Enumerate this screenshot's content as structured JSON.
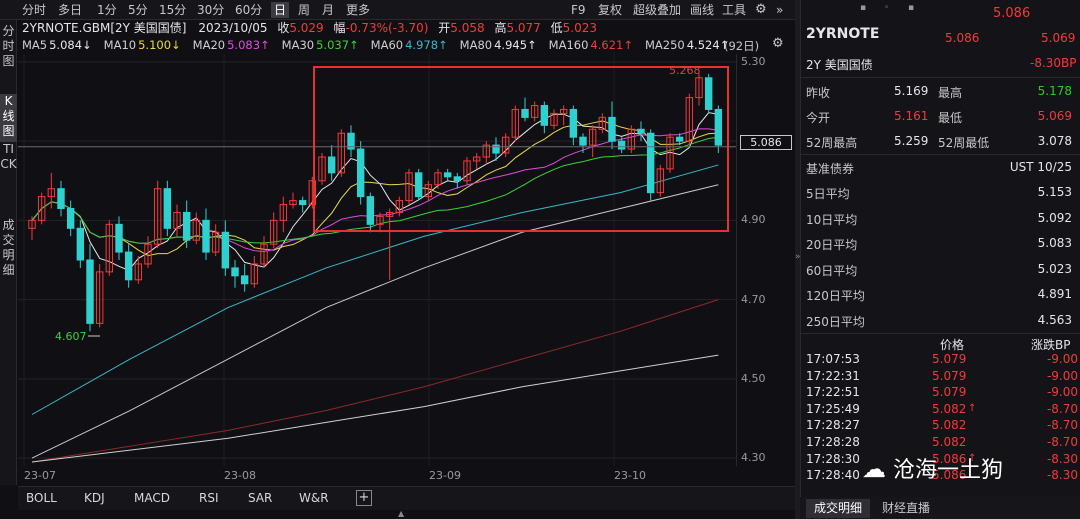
{
  "toolbar": {
    "left": [
      "分时",
      "多日",
      "1分",
      "5分",
      "15分",
      "30分",
      "60分",
      "日",
      "周",
      "月",
      "更多"
    ],
    "right": [
      "F9",
      "复权",
      "超级叠加",
      "画线",
      "工具"
    ],
    "active": "日"
  },
  "leftnav": [
    "分时图",
    "K线图",
    "TICK",
    "成交明细"
  ],
  "title": {
    "symbol": "2YRNOTE.GBM[2Y 美国国债]",
    "date": "2023/10/05",
    "close_label": "收",
    "close": "5.029",
    "change_label": "幅",
    "change": "-0.73%(-3.70)",
    "open_label": "开",
    "open": "5.058",
    "high_label": "高",
    "high": "5.077",
    "low_label": "低",
    "low": "5.023"
  },
  "ma": [
    {
      "label": "MA5",
      "value": "5.084↓",
      "color": "#e8e8e8"
    },
    {
      "label": "MA10",
      "value": "5.100↓",
      "color": "#e8d84a"
    },
    {
      "label": "MA20",
      "value": "5.083↑",
      "color": "#e04ae0"
    },
    {
      "label": "MA30",
      "value": "5.037↑",
      "color": "#3ad23a"
    },
    {
      "label": "MA60",
      "value": "4.978↑",
      "color": "#3ab8c8"
    },
    {
      "label": "MA80",
      "value": "4.945↑",
      "color": "#e8e8e8"
    },
    {
      "label": "MA160",
      "value": "4.621↑",
      "color": "#e04040"
    },
    {
      "label": "MA250",
      "value": "4.524↑",
      "color": "#e8e8e8"
    }
  ],
  "period_badge": "(92日)",
  "y_ticks": [
    "5.30",
    "5.10",
    "4.90",
    "4.70",
    "4.50",
    "4.30"
  ],
  "x_ticks": [
    "23-07",
    "23-08",
    "23-09",
    "23-10"
  ],
  "current_price": "5.086",
  "annotations": {
    "high": "5.268",
    "low": "4.607"
  },
  "indicators": [
    "BOLL",
    "KDJ",
    "MACD",
    "RSI",
    "SAR",
    "W&R"
  ],
  "colors": {
    "up": "#f23a3a",
    "down": "#2fd0d0",
    "highlight": "#e83030"
  },
  "chart_data": {
    "type": "candlestick",
    "ylim": [
      4.28,
      5.32
    ],
    "x_ticks": [
      "23-07",
      "23-08",
      "23-09",
      "23-10"
    ],
    "ohlc": [
      [
        4.88,
        4.91,
        4.85,
        4.9
      ],
      [
        4.9,
        4.97,
        4.89,
        4.96
      ],
      [
        4.96,
        5.02,
        4.93,
        4.98
      ],
      [
        4.98,
        5.0,
        4.91,
        4.93
      ],
      [
        4.93,
        4.95,
        4.86,
        4.88
      ],
      [
        4.88,
        4.9,
        4.78,
        4.8
      ],
      [
        4.8,
        4.84,
        4.62,
        4.64
      ],
      [
        4.64,
        4.79,
        4.63,
        4.77
      ],
      [
        4.77,
        4.9,
        4.76,
        4.89
      ],
      [
        4.89,
        4.91,
        4.8,
        4.82
      ],
      [
        4.82,
        4.84,
        4.73,
        4.75
      ],
      [
        4.75,
        4.81,
        4.74,
        4.79
      ],
      [
        4.79,
        4.86,
        4.78,
        4.84
      ],
      [
        4.84,
        5.0,
        4.83,
        4.98
      ],
      [
        4.98,
        5.0,
        4.86,
        4.88
      ],
      [
        4.88,
        4.94,
        4.86,
        4.92
      ],
      [
        4.92,
        4.95,
        4.83,
        4.85
      ],
      [
        4.85,
        4.92,
        4.84,
        4.9
      ],
      [
        4.9,
        4.93,
        4.8,
        4.82
      ],
      [
        4.82,
        4.89,
        4.81,
        4.87
      ],
      [
        4.87,
        4.9,
        4.76,
        4.78
      ],
      [
        4.78,
        4.8,
        4.73,
        4.76
      ],
      [
        4.76,
        4.79,
        4.72,
        4.74
      ],
      [
        4.74,
        4.81,
        4.73,
        4.79
      ],
      [
        4.79,
        4.86,
        4.78,
        4.84
      ],
      [
        4.84,
        4.92,
        4.83,
        4.9
      ],
      [
        4.9,
        4.96,
        4.87,
        4.94
      ],
      [
        4.94,
        4.97,
        4.93,
        4.95
      ],
      [
        4.95,
        4.96,
        4.92,
        4.94
      ],
      [
        4.94,
        5.01,
        4.93,
        5.0
      ],
      [
        5.0,
        5.07,
        4.99,
        5.06
      ],
      [
        5.06,
        5.09,
        5.0,
        5.02
      ],
      [
        5.02,
        5.13,
        5.01,
        5.12
      ],
      [
        5.12,
        5.14,
        5.06,
        5.08
      ],
      [
        5.08,
        5.1,
        4.94,
        4.96
      ],
      [
        4.96,
        4.97,
        4.87,
        4.89
      ],
      [
        4.89,
        4.92,
        4.87,
        4.91
      ],
      [
        4.91,
        4.93,
        4.75,
        4.92
      ],
      [
        4.92,
        4.96,
        4.91,
        4.95
      ],
      [
        4.95,
        5.03,
        4.94,
        5.02
      ],
      [
        5.02,
        5.03,
        4.95,
        4.96
      ],
      [
        4.96,
        5.0,
        4.95,
        4.99
      ],
      [
        4.99,
        5.03,
        4.98,
        5.02
      ],
      [
        5.02,
        5.03,
        5.0,
        5.01
      ],
      [
        5.01,
        5.02,
        4.98,
        5.0
      ],
      [
        5.0,
        5.06,
        4.99,
        5.05
      ],
      [
        5.05,
        5.07,
        5.03,
        5.06
      ],
      [
        5.06,
        5.1,
        5.04,
        5.09
      ],
      [
        5.09,
        5.11,
        5.05,
        5.07
      ],
      [
        5.07,
        5.12,
        5.06,
        5.11
      ],
      [
        5.11,
        5.19,
        5.1,
        5.18
      ],
      [
        5.18,
        5.21,
        5.15,
        5.16
      ],
      [
        5.16,
        5.2,
        5.15,
        5.19
      ],
      [
        5.19,
        5.2,
        5.12,
        5.14
      ],
      [
        5.14,
        5.18,
        5.13,
        5.17
      ],
      [
        5.17,
        5.19,
        5.14,
        5.18
      ],
      [
        5.18,
        5.19,
        5.09,
        5.11
      ],
      [
        5.11,
        5.12,
        5.07,
        5.09
      ],
      [
        5.09,
        5.14,
        5.06,
        5.13
      ],
      [
        5.13,
        5.17,
        5.12,
        5.16
      ],
      [
        5.16,
        5.2,
        5.08,
        5.1
      ],
      [
        5.1,
        5.11,
        5.07,
        5.08
      ],
      [
        5.08,
        5.14,
        5.07,
        5.13
      ],
      [
        5.13,
        5.15,
        5.1,
        5.12
      ],
      [
        5.12,
        5.13,
        4.95,
        4.97
      ],
      [
        4.97,
        5.04,
        4.96,
        5.03
      ],
      [
        5.03,
        5.12,
        5.02,
        5.11
      ],
      [
        5.11,
        5.12,
        5.09,
        5.1
      ],
      [
        5.1,
        5.22,
        5.09,
        5.21
      ],
      [
        5.21,
        5.27,
        5.19,
        5.26
      ],
      [
        5.26,
        5.27,
        5.17,
        5.18
      ],
      [
        5.18,
        5.19,
        5.07,
        5.09
      ]
    ],
    "ma_overlays": [
      {
        "name": "MA60",
        "color": "#3ab8c8",
        "points": [
          [
            0,
            4.41
          ],
          [
            10,
            4.55
          ],
          [
            20,
            4.68
          ],
          [
            30,
            4.78
          ],
          [
            40,
            4.86
          ],
          [
            50,
            4.92
          ],
          [
            60,
            4.97
          ],
          [
            70,
            5.04
          ]
        ]
      },
      {
        "name": "MA80",
        "color": "#c8c8c8",
        "points": [
          [
            0,
            4.3
          ],
          [
            10,
            4.42
          ],
          [
            20,
            4.55
          ],
          [
            30,
            4.68
          ],
          [
            40,
            4.78
          ],
          [
            50,
            4.87
          ],
          [
            60,
            4.93
          ],
          [
            70,
            4.99
          ]
        ]
      },
      {
        "name": "MA160",
        "color": "#8a2a2a",
        "points": [
          [
            0,
            4.29
          ],
          [
            10,
            4.33
          ],
          [
            20,
            4.37
          ],
          [
            30,
            4.42
          ],
          [
            40,
            4.48
          ],
          [
            50,
            4.55
          ],
          [
            60,
            4.62
          ],
          [
            70,
            4.7
          ]
        ]
      },
      {
        "name": "MA250",
        "color": "#d0d0d0",
        "points": [
          [
            0,
            4.29
          ],
          [
            10,
            4.32
          ],
          [
            20,
            4.35
          ],
          [
            30,
            4.39
          ],
          [
            40,
            4.43
          ],
          [
            50,
            4.48
          ],
          [
            60,
            4.52
          ],
          [
            70,
            4.56
          ]
        ]
      }
    ]
  },
  "rpanel": {
    "top_price": "5.086",
    "name": "2YRNOTE",
    "bid": "5.086",
    "ask": "5.069",
    "subname": "2Y 美国国债",
    "change_bp": "-8.30BP",
    "rows": [
      {
        "l1": "昨收",
        "v1": "5.169",
        "c1": "white",
        "l2": "最高",
        "v2": "5.178",
        "c2": "green"
      },
      {
        "l1": "今开",
        "v1": "5.161",
        "c1": "red",
        "l2": "最低",
        "v2": "5.069",
        "c2": "red"
      },
      {
        "l1": "52周最高",
        "v1": "5.259",
        "c1": "white",
        "l2": "52周最低",
        "v2": "3.078",
        "c2": "white"
      }
    ],
    "bench_label": "基准债券",
    "bench_value": "UST 10/25",
    "averages": [
      {
        "label": "5日平均",
        "value": "5.153"
      },
      {
        "label": "10日平均",
        "value": "5.092"
      },
      {
        "label": "20日平均",
        "value": "5.083"
      },
      {
        "label": "60日平均",
        "value": "5.023"
      },
      {
        "label": "120日平均",
        "value": "4.891"
      },
      {
        "label": "250日平均",
        "value": "4.563"
      }
    ],
    "ticks_header": {
      "price": "价格",
      "change": "涨跌BP"
    },
    "ticks": [
      {
        "time": "17:07:53",
        "price": "5.079",
        "arrow": "",
        "change": "-9.00"
      },
      {
        "time": "17:22:31",
        "price": "5.079",
        "arrow": "",
        "change": "-9.00"
      },
      {
        "time": "17:22:51",
        "price": "5.079",
        "arrow": "",
        "change": "-9.00"
      },
      {
        "time": "17:25:49",
        "price": "5.082",
        "arrow": "↑",
        "change": "-8.70"
      },
      {
        "time": "17:28:27",
        "price": "5.082",
        "arrow": "",
        "change": "-8.70"
      },
      {
        "time": "17:28:28",
        "price": "5.082",
        "arrow": "",
        "change": "-8.70"
      },
      {
        "time": "17:28:30",
        "price": "5.086",
        "arrow": "↑",
        "change": "-8.30"
      },
      {
        "time": "17:28:40",
        "price": "5.086",
        "arrow": "",
        "change": "-8.30"
      }
    ],
    "tabs": [
      "成交明细",
      "财经直播"
    ],
    "watermark": "沧海一土狗"
  }
}
